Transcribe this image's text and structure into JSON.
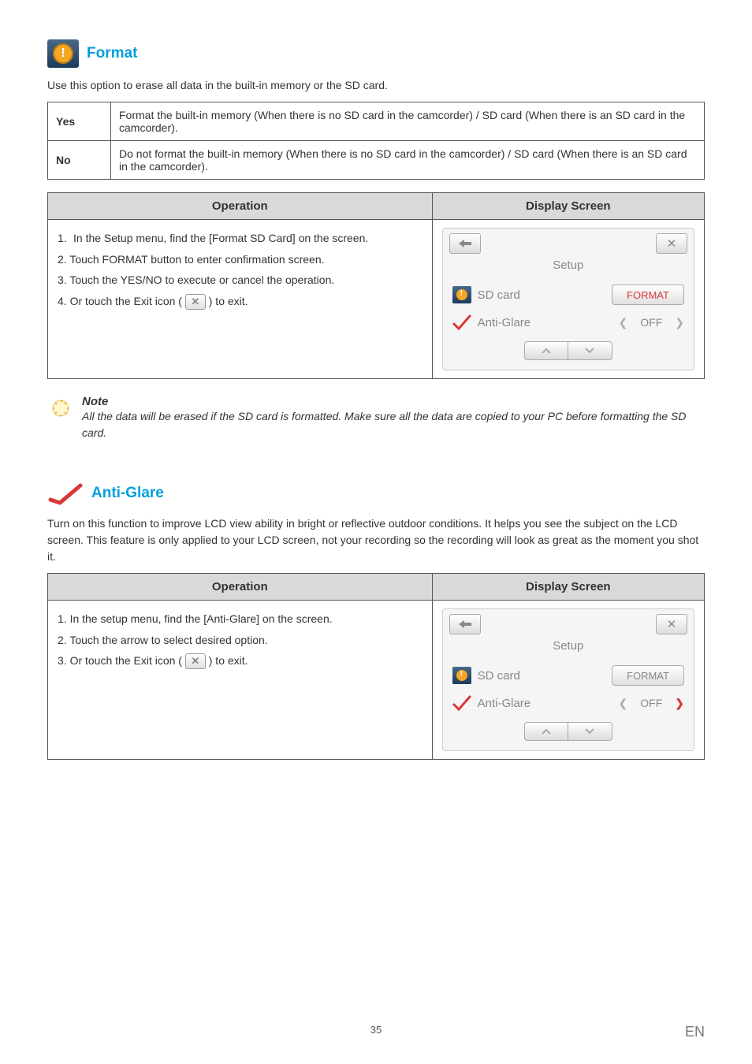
{
  "sections": {
    "format": {
      "title": "Format",
      "intro": "Use this option to erase all data in the built-in memory or the SD card.",
      "rows": [
        {
          "label": "Yes",
          "desc": "Format the built-in memory (When there is no SD card in the camcorder) / SD card (When there is an SD card in the camcorder)."
        },
        {
          "label": "No",
          "desc": "Do not format the built-in memory (When there is no SD card in the camcorder) / SD card (When there is an SD card in the camcorder)."
        }
      ],
      "op_header": "Operation",
      "ds_header": "Display Screen",
      "ops": [
        "1.  In the Setup menu, find the [Format SD Card] on the screen.",
        "2.  Touch FORMAT button to enter confirmation screen.",
        "3.  Touch the YES/NO to execute or cancel the operation.",
        "4.  Or touch the Exit icon ( "
      ],
      "op4_end": " ) to exit.",
      "ds": {
        "title": "Setup",
        "sd_label": "SD card",
        "format_label": "FORMAT",
        "antiglare_label": "Anti-Glare",
        "off_label": "OFF"
      }
    },
    "note": {
      "title": "Note",
      "text": "All the data will be erased if the SD card is formatted. Make sure all the data are copied to your PC before formatting the SD card."
    },
    "antiglare": {
      "title": "Anti-Glare",
      "intro": "Turn on this function to improve LCD view ability in bright or reflective outdoor conditions. It helps you see the subject on the LCD screen. This feature is only applied to your LCD screen, not your recording so the recording will look as great as the moment you shot it.",
      "op_header": "Operation",
      "ds_header": "Display Screen",
      "ops": [
        "1.  In the setup menu, find the [Anti-Glare] on the screen.",
        "2.  Touch the arrow to select desired option.",
        "3.  Or touch the Exit icon ( "
      ],
      "op3_end": " ) to exit.",
      "ds": {
        "title": "Setup",
        "sd_label": "SD card",
        "format_label": "FORMAT",
        "antiglare_label": "Anti-Glare",
        "off_label": "OFF"
      }
    }
  },
  "footer": {
    "page": "35",
    "lang": "EN"
  }
}
